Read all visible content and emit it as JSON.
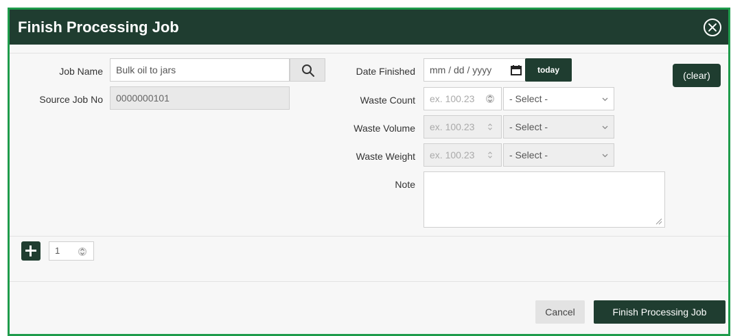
{
  "dialog": {
    "title": "Finish Processing Job",
    "close_icon": "circle-x-icon"
  },
  "left_form": {
    "job_name": {
      "label": "Job Name",
      "value": "Bulk oil to jars",
      "search_icon": "search-icon"
    },
    "source_job_no": {
      "label": "Source Job No",
      "value": "0000000101"
    }
  },
  "right_form": {
    "date_finished": {
      "label": "Date Finished",
      "placeholder": "mm / dd / yyyy",
      "calendar_icon": "calendar-icon",
      "today_label": "today"
    },
    "waste_count": {
      "label": "Waste Count",
      "placeholder": "ex. 100.23",
      "unit": "- Select -"
    },
    "waste_volume": {
      "label": "Waste Volume",
      "placeholder": "ex. 100.23",
      "unit": "- Select -"
    },
    "waste_weight": {
      "label": "Waste Weight",
      "placeholder": "ex. 100.23",
      "unit": "- Select -"
    },
    "note": {
      "label": "Note",
      "value": ""
    },
    "clear_label": "(clear)"
  },
  "quantity": {
    "add_icon": "plus-icon",
    "value": "1"
  },
  "footer": {
    "cancel_label": "Cancel",
    "submit_label": "Finish Processing Job"
  },
  "colors": {
    "header_bg": "#1f3d30",
    "border": "#1e9b4b",
    "button_bg": "#1f3d30"
  }
}
